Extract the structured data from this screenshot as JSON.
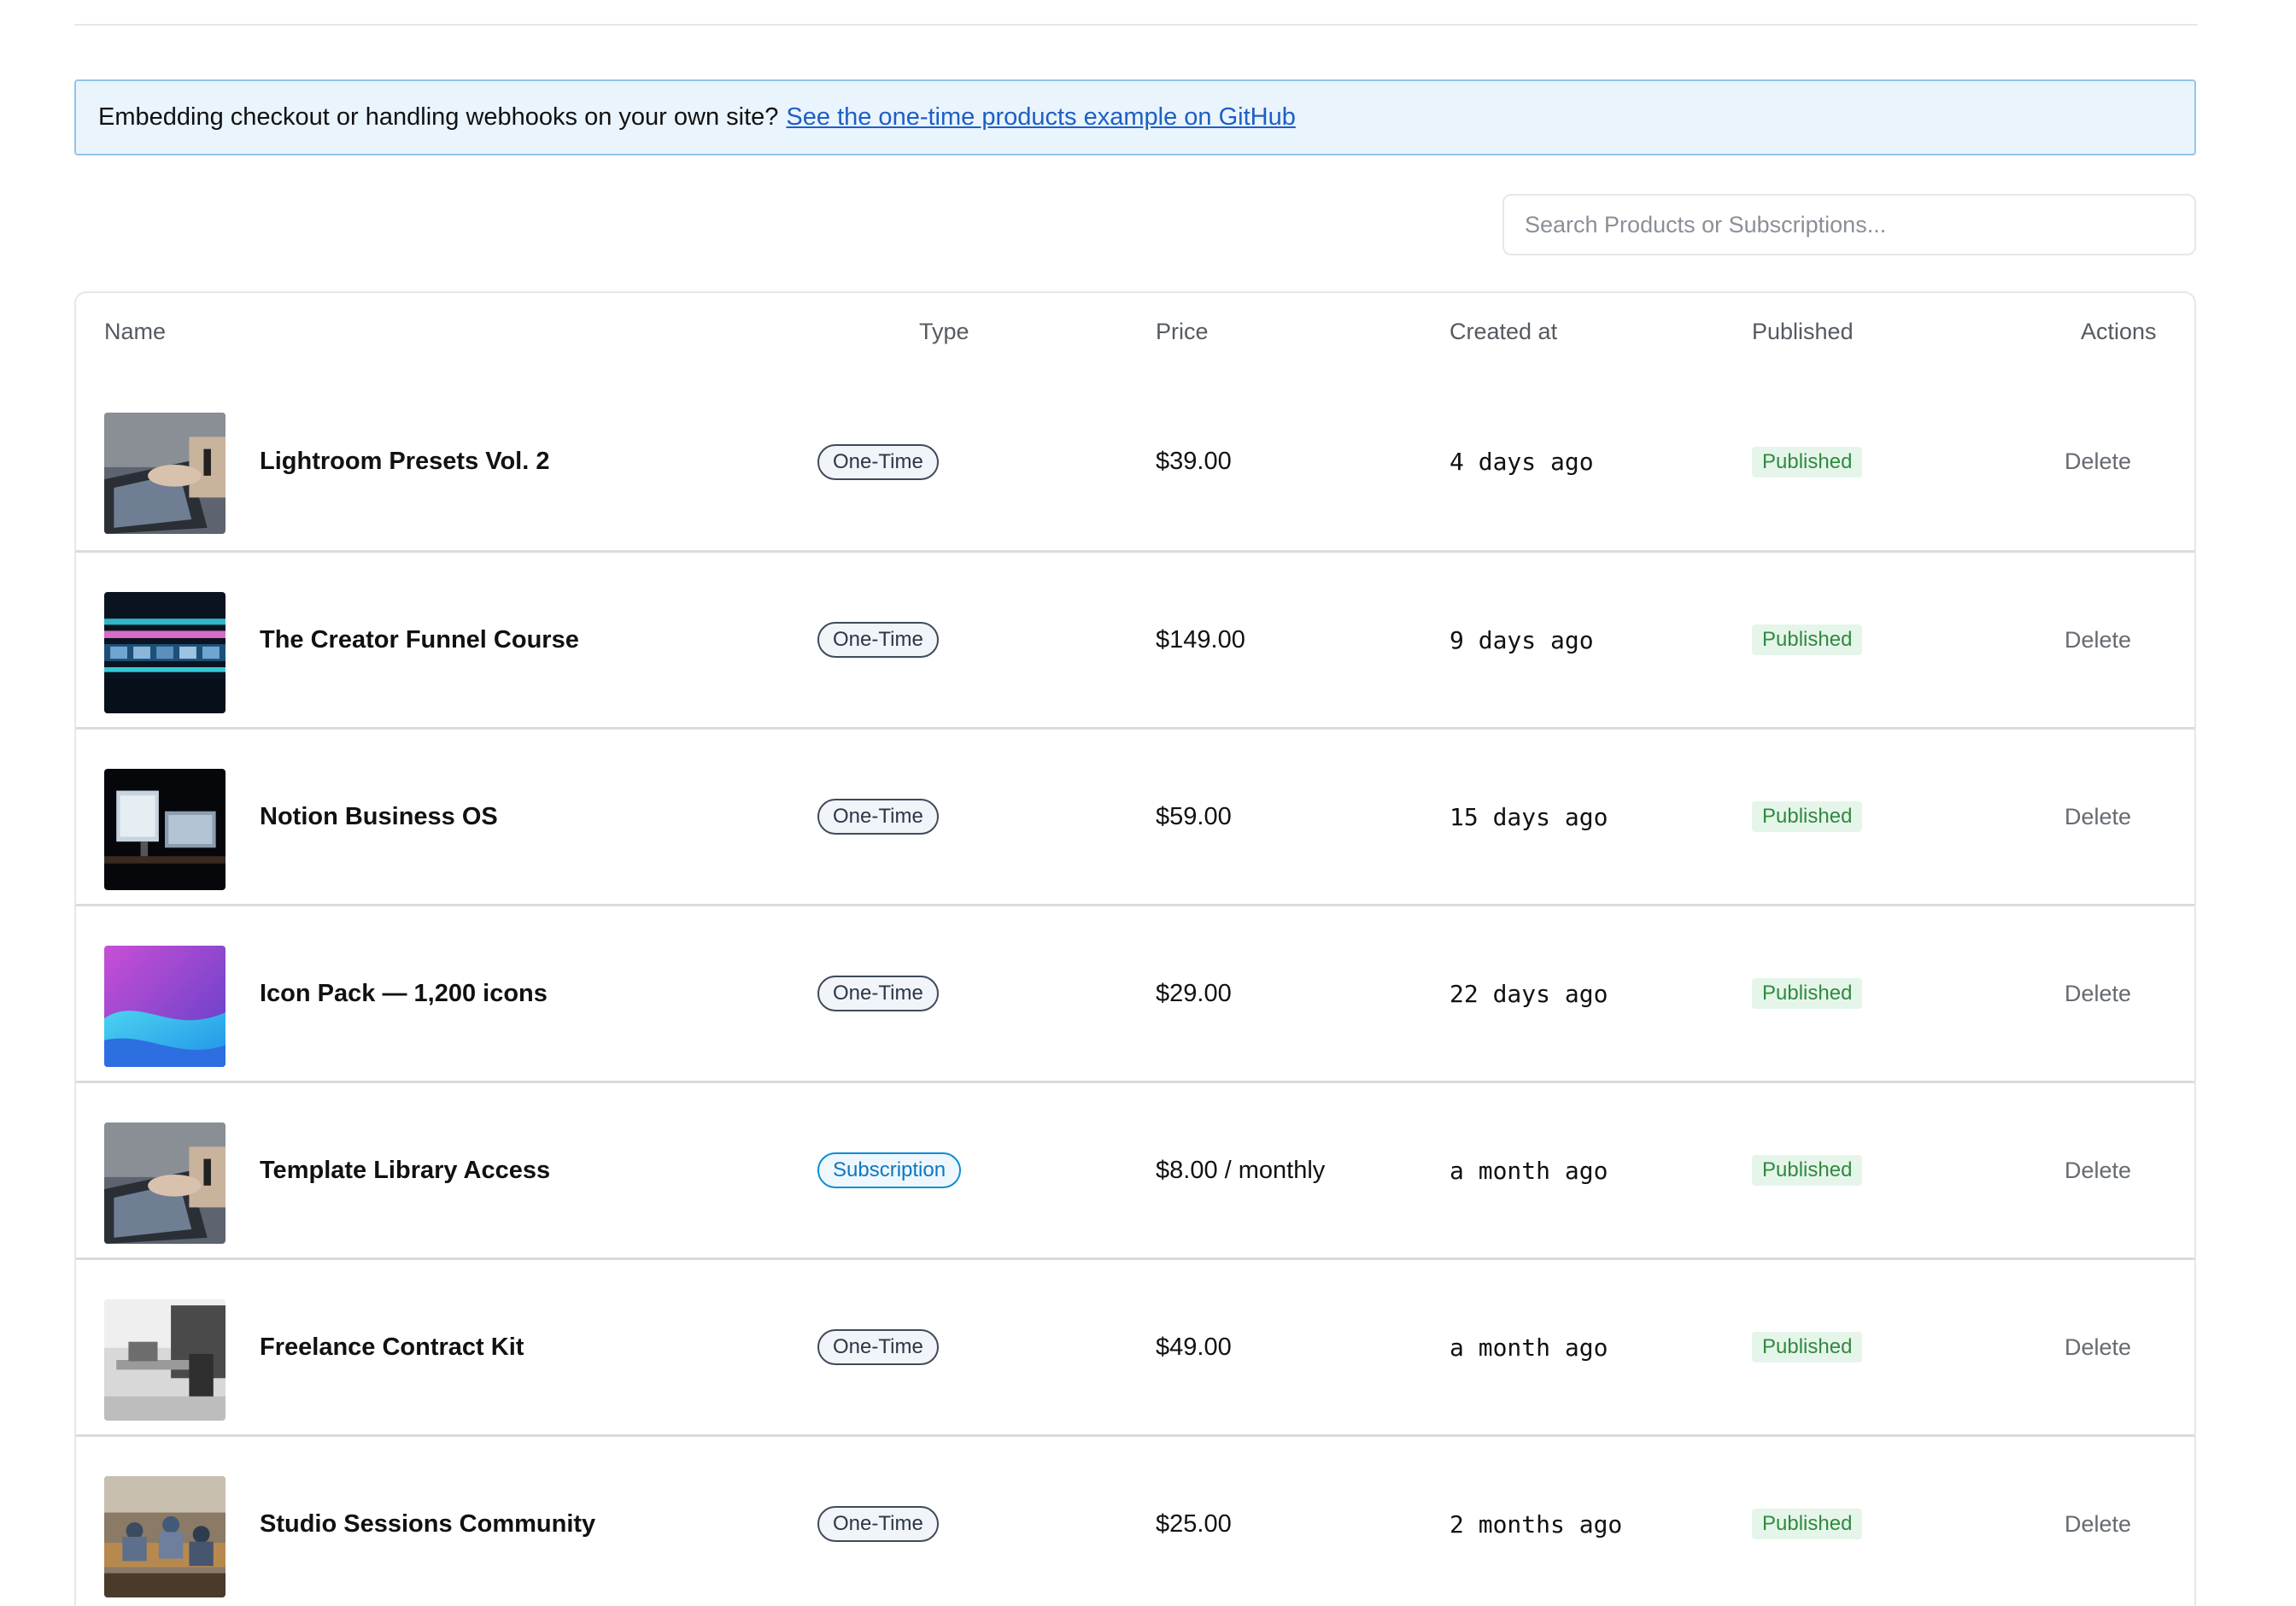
{
  "notice": {
    "text": "Embedding checkout or handling webhooks on your own site?",
    "link_text": "See the one-time products example on GitHub"
  },
  "search": {
    "placeholder": "Search Products or Subscriptions..."
  },
  "table": {
    "headers": {
      "name": "Name",
      "type": "Type",
      "price": "Price",
      "created_at": "Created at",
      "published": "Published",
      "actions": "Actions"
    },
    "rows": [
      {
        "name": "Lightroom Presets Vol. 2",
        "type": "One-Time",
        "price": "$39.00",
        "created": "4 days ago",
        "status": "Published",
        "action": "Delete",
        "thumbnail": "laptop-photo"
      },
      {
        "name": "The Creator Funnel Course",
        "type": "One-Time",
        "price": "$149.00",
        "created": "9 days ago",
        "status": "Published",
        "action": "Delete",
        "thumbnail": "video-timeline-photo"
      },
      {
        "name": "Notion Business OS",
        "type": "One-Time",
        "price": "$59.00",
        "created": "15 days ago",
        "status": "Published",
        "action": "Delete",
        "thumbnail": "desk-monitor-photo"
      },
      {
        "name": "Icon Pack — 1,200 icons",
        "type": "One-Time",
        "price": "$29.00",
        "created": "22 days ago",
        "status": "Published",
        "action": "Delete",
        "thumbnail": "abstract-gradient"
      },
      {
        "name": "Template Library Access",
        "type": "Subscription",
        "price": "$8.00 / monthly",
        "created": "a month ago",
        "status": "Published",
        "action": "Delete",
        "thumbnail": "laptop-photo"
      },
      {
        "name": "Freelance Contract Kit",
        "type": "One-Time",
        "price": "$49.00",
        "created": "a month ago",
        "status": "Published",
        "action": "Delete",
        "thumbnail": "office-bw-photo"
      },
      {
        "name": "Studio Sessions Community",
        "type": "One-Time",
        "price": "$25.00",
        "created": "2 months ago",
        "status": "Published",
        "action": "Delete",
        "thumbnail": "coworking-photo"
      }
    ]
  },
  "colors": {
    "link": "#1d5fc4",
    "notice_bg": "#eaf4fd",
    "published_bg": "#e6f5ea",
    "published_text": "#2f8a3f",
    "subscription": "#0b8ed8"
  }
}
